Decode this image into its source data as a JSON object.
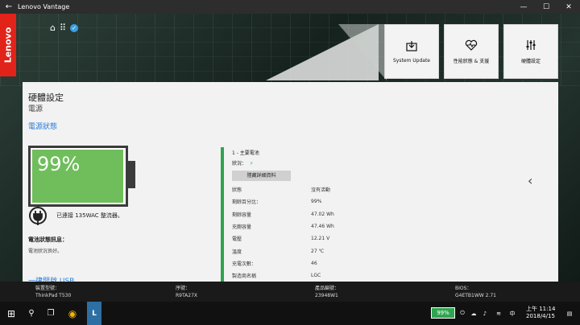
{
  "window": {
    "title": "Lenovo Vantage",
    "back": "←",
    "minimize": "—",
    "maximize": "☐",
    "close": "✕"
  },
  "brand": {
    "logo_text": "Lenovo"
  },
  "tiles": [
    {
      "label": "System Update"
    },
    {
      "label": "性能狀態 & 支援"
    },
    {
      "label": "硬體設定"
    }
  ],
  "page": {
    "title": "硬體設定",
    "subtitle": "電源",
    "section": "電源狀態",
    "battery_percent": "99%",
    "battery_level": 0.99,
    "adapter_text": "已連接 135WAC 整流器。",
    "battery_info_title": "電池狀態訊息：",
    "battery_info_text": "電池狀況良好。",
    "usb_link": "一律開啟 USB"
  },
  "detail": {
    "header": "1 - 主要電池",
    "status_label": "狀況：",
    "status_icon": "⚡",
    "button": "隱藏詳細資料",
    "rows": [
      {
        "key": "狀態",
        "value": "沒有活動"
      },
      {
        "key": "剩餘百分比：",
        "value": "99%"
      },
      {
        "key": "剩餘容量",
        "value": "47.02 Wh"
      },
      {
        "key": "充飽容量",
        "value": "47.46 Wh"
      },
      {
        "key": "電壓",
        "value": "12.21 V"
      },
      {
        "key": "溫度",
        "value": "27 ℃"
      },
      {
        "key": "充電次數：",
        "value": "46"
      },
      {
        "key": "製造商名稱",
        "value": "LGC"
      }
    ]
  },
  "device": [
    {
      "label": "裝置型號：",
      "value": "ThinkPad T530"
    },
    {
      "label": "序號：",
      "value": "R9TA27X"
    },
    {
      "label": "產品編號：",
      "value": "23948W1"
    },
    {
      "label": "BIOS：",
      "value": "G4ETB1WW 2.71"
    }
  ],
  "taskbar": {
    "battery": "99%",
    "ime": "中",
    "time": "上午 11:14",
    "date": "2018/4/15"
  },
  "colors": {
    "accent_green": "#6fbe5b",
    "link_blue": "#2a7bd4",
    "lenovo_red": "#e2231a"
  }
}
